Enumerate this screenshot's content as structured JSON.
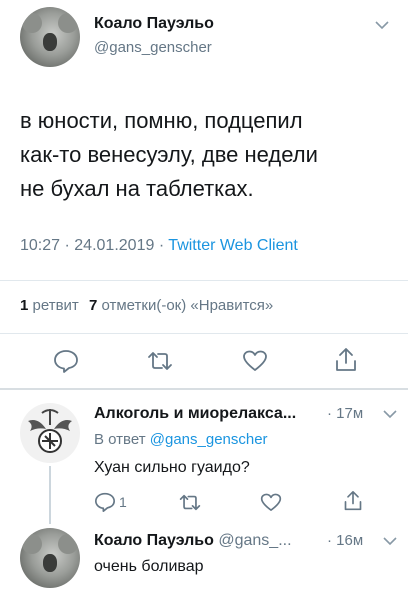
{
  "tweet": {
    "author_name": "Коало Пауэльо",
    "author_handle": "@gans_genscher",
    "text_lines": [
      "в юности, помню, подцепил",
      "как-то венесуэлу, две недели",
      "не бухал на таблетках."
    ],
    "time": "10:27",
    "date": "24.01.2019",
    "sep": "·",
    "client": "Twitter Web Client",
    "retweets_count": "1",
    "retweets_label": "ретвит",
    "likes_count": "7",
    "likes_label": "отметки(-ок) «Нравится»"
  },
  "reply1": {
    "author_name": "Алкоголь и миорелакса...",
    "time": "· 17м",
    "reply_to_label": "В ответ",
    "reply_to_handle": "@gans_genscher",
    "text": "Хуан сильно гуаидо?",
    "reply_count": "1"
  },
  "reply2": {
    "author_name": "Коало Пауэльо",
    "author_handle": "@gans_...",
    "time": "· 16м",
    "text": "очень боливар"
  },
  "icons": {
    "reply": "comment-icon",
    "retweet": "retweet-icon",
    "like": "heart-icon",
    "share": "share-icon",
    "more": "chevron-down-icon"
  },
  "colors": {
    "text": "#14171a",
    "muted": "#657786",
    "link": "#1b95e0",
    "divider": "#e1e8ed"
  }
}
